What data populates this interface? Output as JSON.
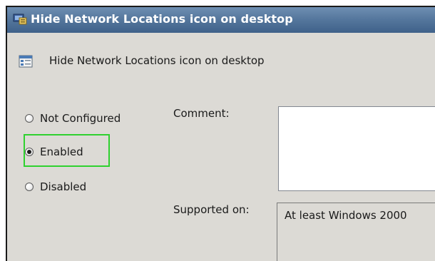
{
  "window": {
    "title": "Hide Network Locations icon on desktop",
    "title_icon": "policy-window-icon"
  },
  "header": {
    "policy_name": "Hide Network Locations icon on desktop",
    "icon": "policy-setting-icon"
  },
  "state_options": {
    "items": [
      {
        "label": "Not Configured",
        "selected": false
      },
      {
        "label": "Enabled",
        "selected": true
      },
      {
        "label": "Disabled",
        "selected": false
      }
    ],
    "highlight_color": "#2fd12f"
  },
  "comment": {
    "label": "Comment:",
    "value": ""
  },
  "supported_on": {
    "label": "Supported on:",
    "value": "At least Windows 2000"
  },
  "colors": {
    "titlebar": "#56789e",
    "dialog_background": "#dcdad5"
  }
}
